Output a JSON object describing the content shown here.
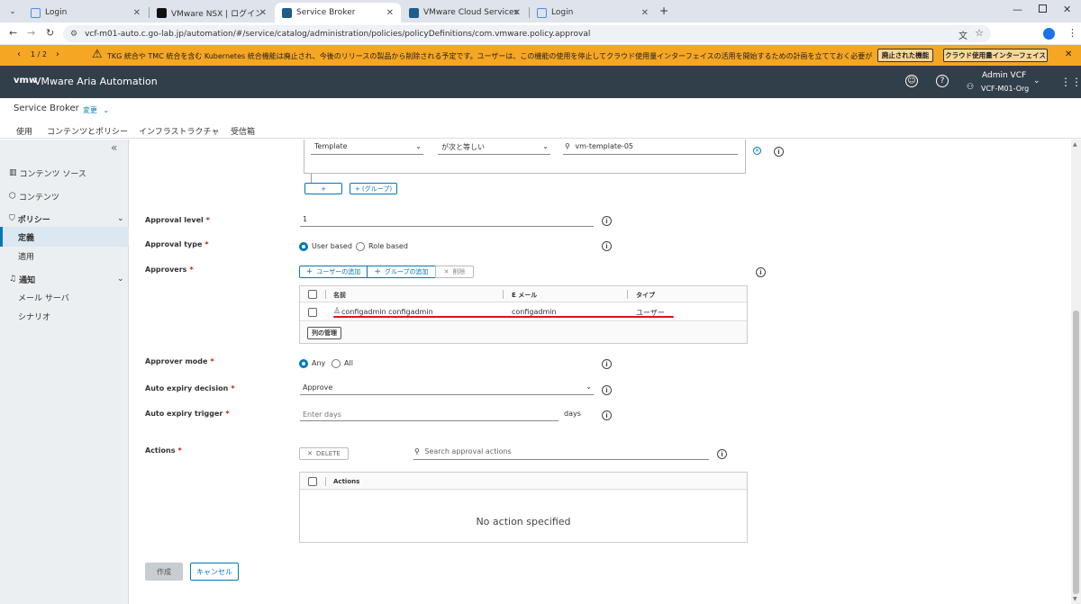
{
  "browser": {
    "tabs": [
      {
        "label": "Login",
        "color": "#4c8bf5"
      },
      {
        "label": "VMware NSX | ログイン",
        "color": "#111111"
      },
      {
        "label": "Service Broker",
        "color": "#1d5c8b"
      },
      {
        "label": "VMware Cloud Services",
        "color": "#1d5c8b"
      },
      {
        "label": "Login",
        "color": "#4c8bf5"
      }
    ],
    "url": "vcf-m01-auto.c.go-lab.jp/automation/#/service/catalog/administration/policies/policyDefinitions/com.vmware.policy.approval"
  },
  "banner": {
    "pager": "1 / 2",
    "message": "TKG 統合や TMC 統合を含む Kubernetes 統合機能は廃止され、今後のリリースの製品から削除される予定です。ユーザーは、この機能の使用を停止してクラウド使用量インターフェイスの活用を開始するための計画を立てておく必要があります。",
    "btn_deprecated": "廃止された機能",
    "btn_cloud_usage": "クラウド使用量インターフェイス",
    "color": "#f5a623"
  },
  "app": {
    "logo": "vmw",
    "title": "VMware Aria Automation",
    "user_name": "Admin VCF",
    "org": "VCF-M01-Org",
    "header_color": "#313f4a"
  },
  "sub": {
    "title": "Service Broker",
    "change": "変更",
    "tabs": [
      "使用",
      "コンテンツとポリシー",
      "インフラストラクチャ",
      "受信箱"
    ]
  },
  "sidebar": {
    "collapse": "«",
    "content_source": "コンテンツ ソース",
    "content": "コンテンツ",
    "policy": "ポリシー",
    "definition": "定義",
    "enforcement": "適用",
    "notification": "通知",
    "mail_server": "メール サーバ",
    "scenario": "シナリオ"
  },
  "criteria": {
    "field": "Template",
    "operator": "が次と等しい",
    "value": "vm-template-05",
    "add": "+",
    "add_group": "+ (グループ)"
  },
  "approval_level": {
    "label": "Approval level",
    "value": "1"
  },
  "approval_type": {
    "label": "Approval type",
    "options": [
      "User based",
      "Role based"
    ],
    "selected": "User based"
  },
  "approvers": {
    "label": "Approvers",
    "add_user": "ユーザーの追加",
    "add_group": "グループの追加",
    "delete": "削除",
    "columns": [
      "名前",
      "E メール",
      "タイプ"
    ],
    "rows": [
      {
        "name": "configadmin configadmin",
        "email": "configadmin",
        "type": "ユーザー"
      }
    ],
    "manage_columns": "列の管理"
  },
  "approver_mode": {
    "label": "Approver mode",
    "options": [
      "Any",
      "All"
    ],
    "selected": "Any"
  },
  "auto_expiry_decision": {
    "label": "Auto expiry decision",
    "value": "Approve"
  },
  "auto_expiry_trigger": {
    "label": "Auto expiry trigger",
    "placeholder": "Enter days",
    "unit": "days"
  },
  "actions": {
    "label": "Actions",
    "delete": "DELETE",
    "search_placeholder": "Search approval actions",
    "column": "Actions",
    "empty": "No action specified"
  },
  "footer": {
    "create": "作成",
    "cancel": "キャンセル"
  }
}
